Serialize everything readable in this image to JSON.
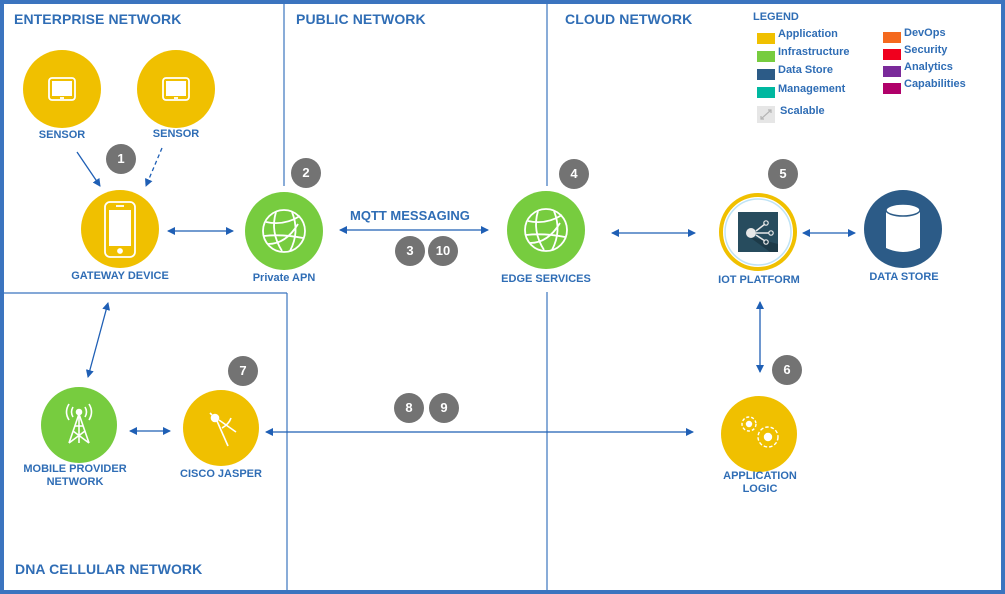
{
  "zones": {
    "enterprise": "ENTERPRISE NETWORK",
    "public": "PUBLIC NETWORK",
    "cloud": "CLOUD NETWORK",
    "cellular": "DNA CELLULAR NETWORK"
  },
  "legend": {
    "title": "LEGEND",
    "items": [
      {
        "label": "Application",
        "color": "#f0c000"
      },
      {
        "label": "Infrastructure",
        "color": "#77cc3f"
      },
      {
        "label": "Data Store",
        "color": "#2c5b87"
      },
      {
        "label": "Management",
        "color": "#00b8a0"
      },
      {
        "label": "DevOps",
        "color": "#f4691e"
      },
      {
        "label": "Security",
        "color": "#f0001e"
      },
      {
        "label": "Analytics",
        "color": "#7a2a9a"
      },
      {
        "label": "Capabilities",
        "color": "#b0006a"
      }
    ],
    "scalable": {
      "label": "Scalable",
      "icon": "expand-arrows-icon"
    }
  },
  "nodes": {
    "sensor1": {
      "label": "SENSOR",
      "icon": "tablet-icon",
      "category": "Application"
    },
    "sensor2": {
      "label": "SENSOR",
      "icon": "tablet-icon",
      "category": "Application"
    },
    "gateway": {
      "label": "GATEWAY DEVICE",
      "icon": "smartphone-icon",
      "category": "Application"
    },
    "private_apn": {
      "label": "Private APN",
      "icon": "globe-icon",
      "category": "Infrastructure"
    },
    "edge": {
      "label": "EDGE SERVICES",
      "icon": "globe-icon",
      "category": "Infrastructure"
    },
    "iot": {
      "label": "IOT PLATFORM",
      "icon": "iot-platform-icon",
      "category": "Application"
    },
    "datastore": {
      "label": "DATA STORE",
      "icon": "database-cylinder-icon",
      "category": "Data Store"
    },
    "mobile": {
      "label_line1": "MOBILE PROVIDER",
      "label_line2": "NETWORK",
      "icon": "cell-tower-icon",
      "category": "Infrastructure"
    },
    "jasper": {
      "label": "CISCO JASPER",
      "icon": "compass-icon",
      "category": "Application"
    },
    "applogic": {
      "label_line1": "APPLICATION",
      "label_line2": "LOGIC",
      "icon": "gears-icon",
      "category": "Application"
    }
  },
  "flows": {
    "mqtt_label": "MQTT MESSAGING"
  },
  "steps": [
    "1",
    "2",
    "3",
    "10",
    "4",
    "5",
    "6",
    "7",
    "8",
    "9"
  ],
  "colors": {
    "border": "#3b74bf",
    "arrow": "#1f5fb5",
    "label": "#2f6db5",
    "badge": "#737373"
  }
}
